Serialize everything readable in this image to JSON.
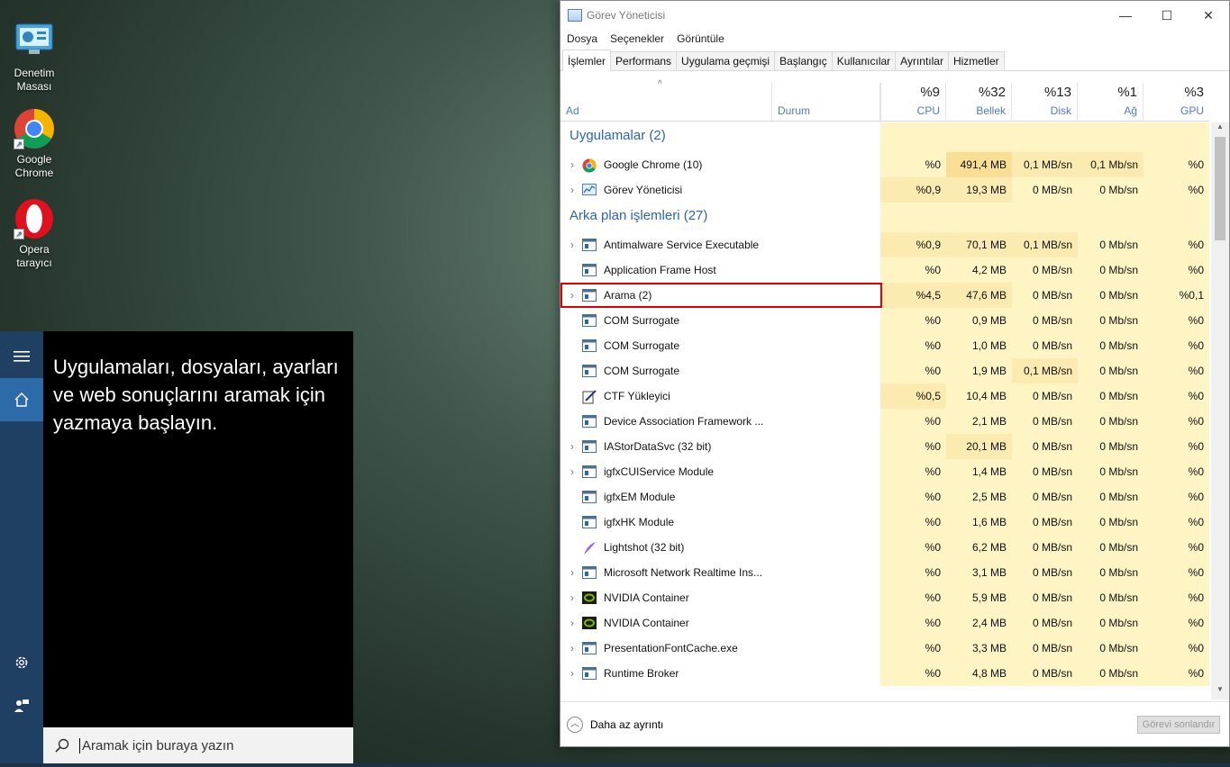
{
  "desktop": {
    "icons": [
      {
        "label": "Denetim Masası",
        "icon": "control-panel-icon"
      },
      {
        "label": "Google Chrome",
        "icon": "chrome-icon"
      },
      {
        "label": "Opera tarayıcı",
        "icon": "opera-icon"
      }
    ]
  },
  "start": {
    "hint": "Uygulamaları, dosyaları, ayarları ve web sonuçlarını aramak için yazmaya başlayın.",
    "search_placeholder": "Aramak için buraya yazın"
  },
  "taskmgr": {
    "title": "Görev Yöneticisi",
    "menu": [
      "Dosya",
      "Seçenekler",
      "Görüntüle"
    ],
    "tabs": [
      "İşlemler",
      "Performans",
      "Uygulama geçmişi",
      "Başlangıç",
      "Kullanıcılar",
      "Ayrıntılar",
      "Hizmetler"
    ],
    "active_tab": "İşlemler",
    "columns": {
      "name": "Ad",
      "status": "Durum",
      "cpu": {
        "pct": "%9",
        "label": "CPU"
      },
      "mem": {
        "pct": "%32",
        "label": "Bellek"
      },
      "disk": {
        "pct": "%13",
        "label": "Disk"
      },
      "net": {
        "pct": "%1",
        "label": "Ağ"
      },
      "gpu": {
        "pct": "%3",
        "label": "GPU"
      }
    },
    "groups": [
      {
        "title": "Uygulamalar (2)",
        "rows": [
          {
            "name": "Google Chrome (10)",
            "expand": true,
            "icon": "chrome-icon",
            "cpu": "%0",
            "mem": "491,4 MB",
            "disk": "0,1 MB/sn",
            "net": "0,1 Mb/sn",
            "gpu": "%0"
          },
          {
            "name": "Görev Yöneticisi",
            "expand": true,
            "icon": "taskmgr-icon",
            "cpu": "%0,9",
            "mem": "19,3 MB",
            "disk": "0 MB/sn",
            "net": "0 Mb/sn",
            "gpu": "%0"
          }
        ]
      },
      {
        "title": "Arka plan işlemleri (27)",
        "rows": [
          {
            "name": "Antimalware Service Executable",
            "expand": true,
            "icon": "service-icon",
            "cpu": "%0,9",
            "mem": "70,1 MB",
            "disk": "0,1 MB/sn",
            "net": "0 Mb/sn",
            "gpu": "%0"
          },
          {
            "name": "Application Frame Host",
            "expand": false,
            "icon": "service-icon",
            "cpu": "%0",
            "mem": "4,2 MB",
            "disk": "0 MB/sn",
            "net": "0 Mb/sn",
            "gpu": "%0"
          },
          {
            "name": "Arama (2)",
            "expand": true,
            "icon": "service-icon",
            "cpu": "%4,5",
            "mem": "47,6 MB",
            "disk": "0 MB/sn",
            "net": "0 Mb/sn",
            "gpu": "%0,1",
            "highlighted": true
          },
          {
            "name": "COM Surrogate",
            "expand": false,
            "icon": "service-icon",
            "cpu": "%0",
            "mem": "0,9 MB",
            "disk": "0 MB/sn",
            "net": "0 Mb/sn",
            "gpu": "%0"
          },
          {
            "name": "COM Surrogate",
            "expand": false,
            "icon": "service-icon",
            "cpu": "%0",
            "mem": "1,0 MB",
            "disk": "0 MB/sn",
            "net": "0 Mb/sn",
            "gpu": "%0"
          },
          {
            "name": "COM Surrogate",
            "expand": false,
            "icon": "service-icon",
            "cpu": "%0",
            "mem": "1,9 MB",
            "disk": "0,1 MB/sn",
            "net": "0 Mb/sn",
            "gpu": "%0"
          },
          {
            "name": "CTF Yükleyici",
            "expand": false,
            "icon": "ctf-icon",
            "cpu": "%0,5",
            "mem": "10,4 MB",
            "disk": "0 MB/sn",
            "net": "0 Mb/sn",
            "gpu": "%0"
          },
          {
            "name": "Device Association Framework ...",
            "expand": false,
            "icon": "service-icon",
            "cpu": "%0",
            "mem": "2,1 MB",
            "disk": "0 MB/sn",
            "net": "0 Mb/sn",
            "gpu": "%0"
          },
          {
            "name": "IAStorDataSvc (32 bit)",
            "expand": true,
            "icon": "service-icon",
            "cpu": "%0",
            "mem": "20,1 MB",
            "disk": "0 MB/sn",
            "net": "0 Mb/sn",
            "gpu": "%0"
          },
          {
            "name": "igfxCUIService Module",
            "expand": true,
            "icon": "service-icon",
            "cpu": "%0",
            "mem": "1,4 MB",
            "disk": "0 MB/sn",
            "net": "0 Mb/sn",
            "gpu": "%0"
          },
          {
            "name": "igfxEM Module",
            "expand": false,
            "icon": "service-icon",
            "cpu": "%0",
            "mem": "2,5 MB",
            "disk": "0 MB/sn",
            "net": "0 Mb/sn",
            "gpu": "%0"
          },
          {
            "name": "igfxHK Module",
            "expand": false,
            "icon": "service-icon",
            "cpu": "%0",
            "mem": "1,6 MB",
            "disk": "0 MB/sn",
            "net": "0 Mb/sn",
            "gpu": "%0"
          },
          {
            "name": "Lightshot (32 bit)",
            "expand": false,
            "icon": "lightshot-icon",
            "cpu": "%0",
            "mem": "6,2 MB",
            "disk": "0 MB/sn",
            "net": "0 Mb/sn",
            "gpu": "%0"
          },
          {
            "name": "Microsoft Network Realtime Ins...",
            "expand": true,
            "icon": "service-icon",
            "cpu": "%0",
            "mem": "3,1 MB",
            "disk": "0 MB/sn",
            "net": "0 Mb/sn",
            "gpu": "%0"
          },
          {
            "name": "NVIDIA Container",
            "expand": true,
            "icon": "nvidia-icon",
            "cpu": "%0",
            "mem": "5,9 MB",
            "disk": "0 MB/sn",
            "net": "0 Mb/sn",
            "gpu": "%0"
          },
          {
            "name": "NVIDIA Container",
            "expand": true,
            "icon": "nvidia-icon",
            "cpu": "%0",
            "mem": "2,4 MB",
            "disk": "0 MB/sn",
            "net": "0 Mb/sn",
            "gpu": "%0"
          },
          {
            "name": "PresentationFontCache.exe",
            "expand": true,
            "icon": "service-icon",
            "cpu": "%0",
            "mem": "3,3 MB",
            "disk": "0 MB/sn",
            "net": "0 Mb/sn",
            "gpu": "%0"
          },
          {
            "name": "Runtime Broker",
            "expand": true,
            "icon": "service-icon",
            "cpu": "%0",
            "mem": "4,8 MB",
            "disk": "0 MB/sn",
            "net": "0 Mb/sn",
            "gpu": "%0"
          }
        ]
      }
    ],
    "footer": {
      "less_details": "Daha az ayrıntı",
      "end_task": "Görevi sonlandır"
    },
    "colors": {
      "accent": "#2a66b5",
      "highlight_border": "#e00000",
      "heat_light": "#fff4c4",
      "heat_mid": "#fcebb0",
      "heat_strong": "#f9df93"
    }
  }
}
